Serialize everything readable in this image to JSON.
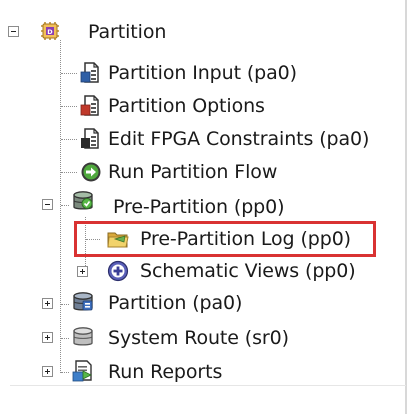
{
  "tree": {
    "root": {
      "label": "Partition",
      "icon": "chip-icon",
      "expanded": true
    },
    "items": [
      {
        "label": "Partition Input (pa0)",
        "icon": "document-input-icon"
      },
      {
        "label": "Partition Options",
        "icon": "document-options-icon"
      },
      {
        "label": "Edit FPGA Constraints (pa0)",
        "icon": "document-edit-icon"
      },
      {
        "label": "Run Partition Flow",
        "icon": "run-arrow-icon"
      },
      {
        "label": "Pre-Partition (pp0)",
        "icon": "database-green-icon",
        "expanded": true
      },
      {
        "label": "Pre-Partition Log (pp0)",
        "icon": "log-folder-icon",
        "highlighted": true
      },
      {
        "label": "Schematic Views (pp0)",
        "icon": "schematic-view-icon",
        "expanded": false
      },
      {
        "label": "Partition (pa0)",
        "icon": "database-blue-icon",
        "expanded": false
      },
      {
        "label": "System Route (sr0)",
        "icon": "database-gray-icon",
        "expanded": false
      },
      {
        "label": "Run Reports",
        "icon": "reports-icon",
        "expanded": false
      }
    ]
  },
  "colors": {
    "highlight_border": "#d93232",
    "guide_lines": "#8f8f8f"
  }
}
